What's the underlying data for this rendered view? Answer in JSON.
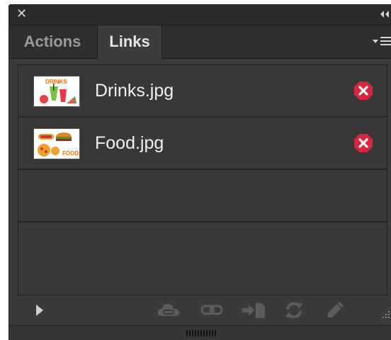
{
  "panel": {
    "close_glyph": "✕",
    "collapse_icon": "double-chevron-left-icon"
  },
  "tabs": [
    {
      "label": "Actions",
      "active": false
    },
    {
      "label": "Links",
      "active": true
    }
  ],
  "flyout_icon": "panel-menu-icon",
  "links": [
    {
      "filename": "Drinks.jpg",
      "thumbnail_text": "DRINKS",
      "status_icon": "missing-link-icon"
    },
    {
      "filename": "Food.jpg",
      "thumbnail_text": "FOOD",
      "status_icon": "missing-link-icon"
    }
  ],
  "footer_icons": [
    "expand-triangle-icon",
    "cloud-link-icon",
    "relink-icon",
    "goto-link-icon",
    "update-link-icon",
    "edit-original-icon"
  ],
  "colors": {
    "panel_bg": "#3a3a3a",
    "titlebar_bg": "#2b2b2b",
    "active_tab_text": "#e6e6e6",
    "inactive_tab_text": "#9b9b9b",
    "error_red": "#d7263d",
    "icon_disabled": "#5c5c5c"
  }
}
